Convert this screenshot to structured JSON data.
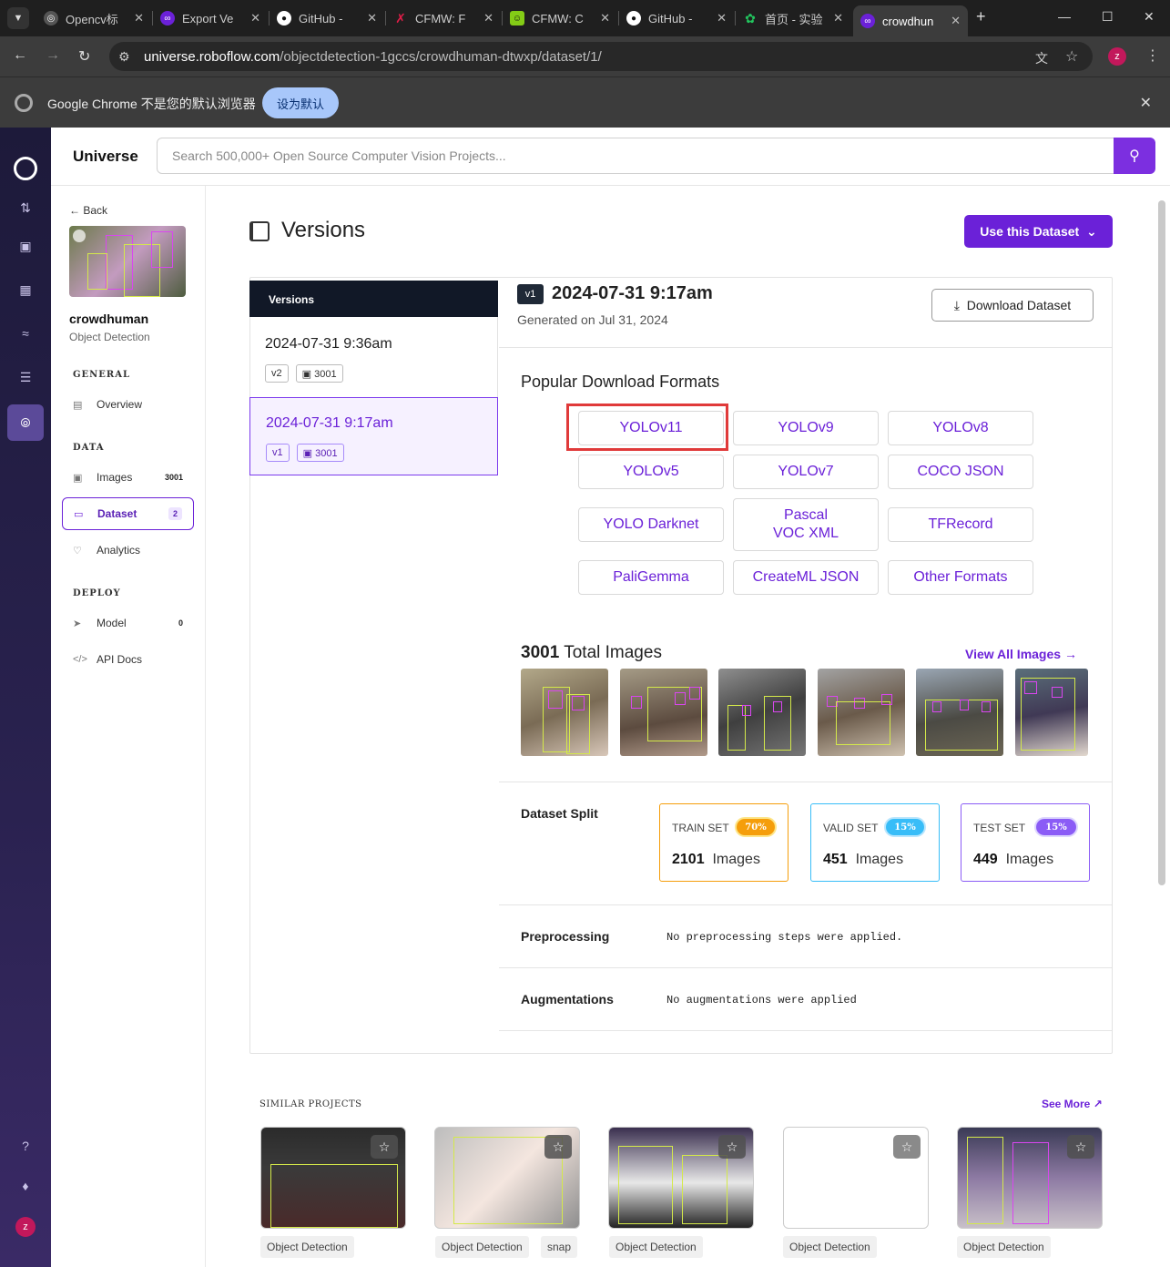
{
  "browser": {
    "tabs": [
      {
        "label": "Opencv标",
        "icon": "globe-icon"
      },
      {
        "label": "Export Ve",
        "icon": "roboflow-icon"
      },
      {
        "label": "GitHub - ",
        "icon": "github-icon"
      },
      {
        "label": "CFMW: F",
        "icon": "x-logo-icon"
      },
      {
        "label": "CFMW: C",
        "icon": "smiley-icon"
      },
      {
        "label": "GitHub - ",
        "icon": "github-icon"
      },
      {
        "label": "首页 - 实验",
        "icon": "flower-icon"
      },
      {
        "label": "crowdhun",
        "icon": "roboflow-icon"
      }
    ],
    "url_host": "universe.roboflow.com",
    "url_path": "/objectdetection-1gccs/crowdhuman-dtwxp/dataset/1/",
    "profile_initial": "z",
    "infobar_message": "Google Chrome 不是您的默认浏览器",
    "infobar_button": "设为默认"
  },
  "header": {
    "brand": "Universe",
    "search_placeholder": "Search 500,000+ Open Source Computer Vision Projects..."
  },
  "sidebar": {
    "back": "Back",
    "project_name": "crowdhuman",
    "project_type": "Object Detection",
    "sections": {
      "general": "GENERAL",
      "data": "DATA",
      "deploy": "DEPLOY"
    },
    "items": {
      "overview": {
        "label": "Overview"
      },
      "images": {
        "label": "Images",
        "count": "3001"
      },
      "dataset": {
        "label": "Dataset",
        "count": "2"
      },
      "analytics": {
        "label": "Analytics"
      },
      "model": {
        "label": "Model",
        "count": "0"
      },
      "api_docs": {
        "label": "API Docs"
      }
    }
  },
  "page": {
    "title": "Versions",
    "use_button": "Use this Dataset"
  },
  "versions": {
    "header": "Versions",
    "list": [
      {
        "date": "2024-07-31 9:36am",
        "version": "v2",
        "images": "3001"
      },
      {
        "date": "2024-07-31 9:17am",
        "version": "v1",
        "images": "3001"
      }
    ]
  },
  "detail": {
    "version": "v1",
    "title": "2024-07-31 9:17am",
    "generated": "Generated on Jul 31, 2024",
    "download_button": "Download Dataset",
    "formats_title": "Popular Download Formats",
    "formats": [
      "YOLOv11",
      "YOLOv9",
      "YOLOv8",
      "YOLOv5",
      "YOLOv7",
      "COCO JSON",
      "YOLO Darknet",
      "Pascal VOC XML",
      "TFRecord",
      "PaliGemma",
      "CreateML JSON",
      "Other Formats"
    ],
    "total_count": "3001",
    "total_label": "Total Images",
    "view_all": "View All Images",
    "split_label": "Dataset Split",
    "splits": [
      {
        "name": "TRAIN SET",
        "pct": "70%",
        "count": "2101",
        "unit": "Images",
        "color": "#f59e0b"
      },
      {
        "name": "VALID SET",
        "pct": "15%",
        "count": "451",
        "unit": "Images",
        "color": "#38bdf8"
      },
      {
        "name": "TEST SET",
        "pct": "15%",
        "count": "449",
        "unit": "Images",
        "color": "#8b5cf6"
      }
    ],
    "preprocessing_label": "Preprocessing",
    "preprocessing_value": "No preprocessing steps were applied.",
    "augmentations_label": "Augmentations",
    "augmentations_value": "No augmentations were applied"
  },
  "similar": {
    "title": "SIMILAR PROJECTS",
    "see_more": "See More",
    "tags": [
      "Object Detection",
      "Object Detection",
      "snap",
      "Object Detection",
      "Object Detection",
      "Object Detection"
    ]
  },
  "colors": {
    "accent": "#6b21d8",
    "highlight": "#e03a3a"
  }
}
